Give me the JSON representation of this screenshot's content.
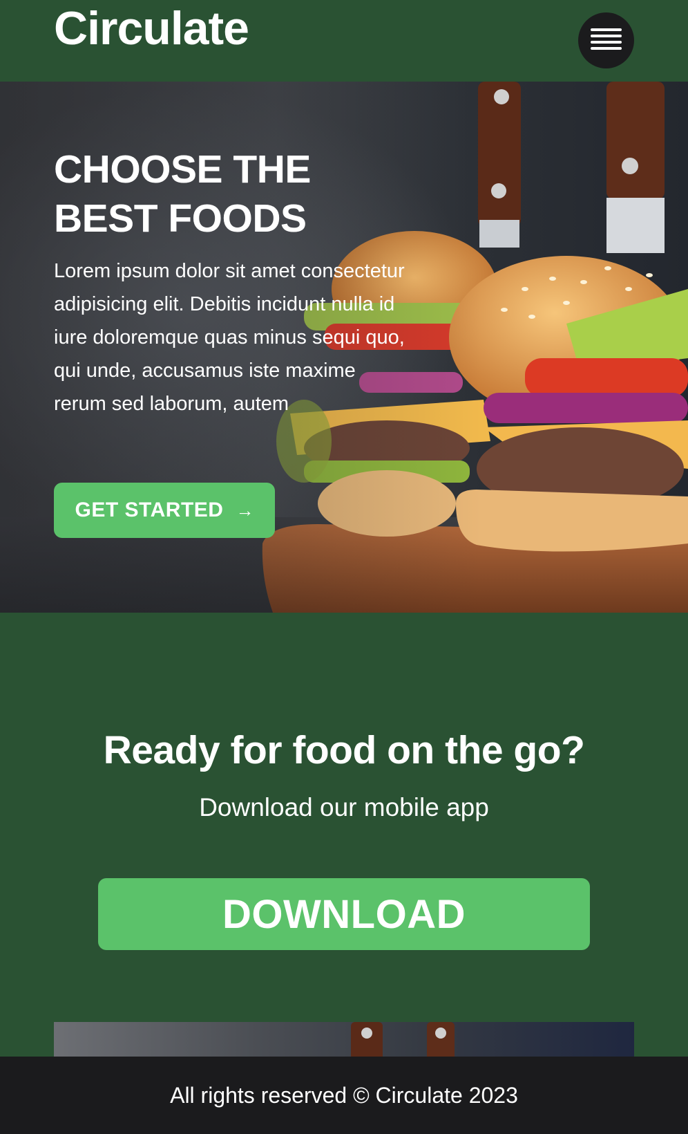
{
  "header": {
    "logo": "Circulate",
    "menu_icon": "hamburger-icon"
  },
  "hero": {
    "title": "CHOOSE THE BEST FOODS",
    "text": "Lorem ipsum dolor sit amet consectetur adipisicing elit. Debitis incidunt nulla id iure doloremque quas minus sequi quo, qui unde, accusamus iste maxime rerum sed laborum, autem",
    "cta_label": "GET STARTED",
    "cta_icon": "arrow-right-icon",
    "image": "burgers-photo"
  },
  "app": {
    "title": "Ready for food on the go?",
    "subtitle": "Download our mobile app",
    "download_label": "DOWNLOAD"
  },
  "footer": {
    "text": "All rights reserved © Circulate 2023"
  },
  "colors": {
    "brand_green": "#2a5233",
    "accent_green": "#5bc26a",
    "dark": "#1b1b1d"
  }
}
